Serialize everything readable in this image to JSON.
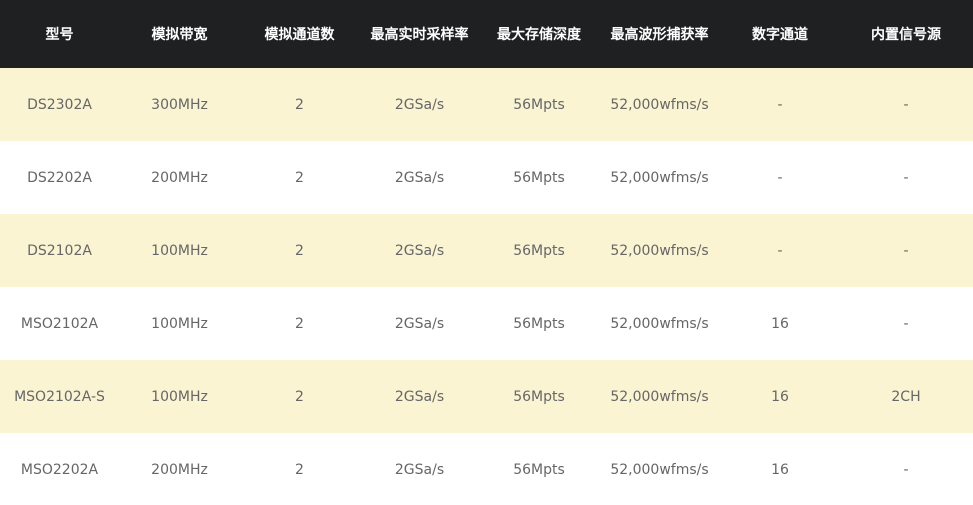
{
  "table": {
    "headers": [
      "型号",
      "模拟带宽",
      "模拟通道数",
      "最高实时采样率",
      "最大存储深度",
      "最高波形捕获率",
      "数字通道",
      "内置信号源"
    ],
    "rows": [
      [
        "DS2302A",
        "300MHz",
        "2",
        "2GSa/s",
        "56Mpts",
        "52,000wfms/s",
        "-",
        "-"
      ],
      [
        "DS2202A",
        "200MHz",
        "2",
        "2GSa/s",
        "56Mpts",
        "52,000wfms/s",
        "-",
        "-"
      ],
      [
        "DS2102A",
        "100MHz",
        "2",
        "2GSa/s",
        "56Mpts",
        "52,000wfms/s",
        "-",
        "-"
      ],
      [
        "MSO2102A",
        "100MHz",
        "2",
        "2GSa/s",
        "56Mpts",
        "52,000wfms/s",
        "16",
        "-"
      ],
      [
        "MSO2102A-S",
        "100MHz",
        "2",
        "2GSa/s",
        "56Mpts",
        "52,000wfms/s",
        "16",
        "2CH"
      ],
      [
        "MSO2202A",
        "200MHz",
        "2",
        "2GSa/s",
        "56Mpts",
        "52,000wfms/s",
        "16",
        "-"
      ]
    ]
  },
  "colors": {
    "header_bg": "#1f2022",
    "header_text": "#ffffff",
    "stripe_bg": "#faf4d3",
    "row_bg": "#ffffff",
    "cell_text": "#666666"
  }
}
